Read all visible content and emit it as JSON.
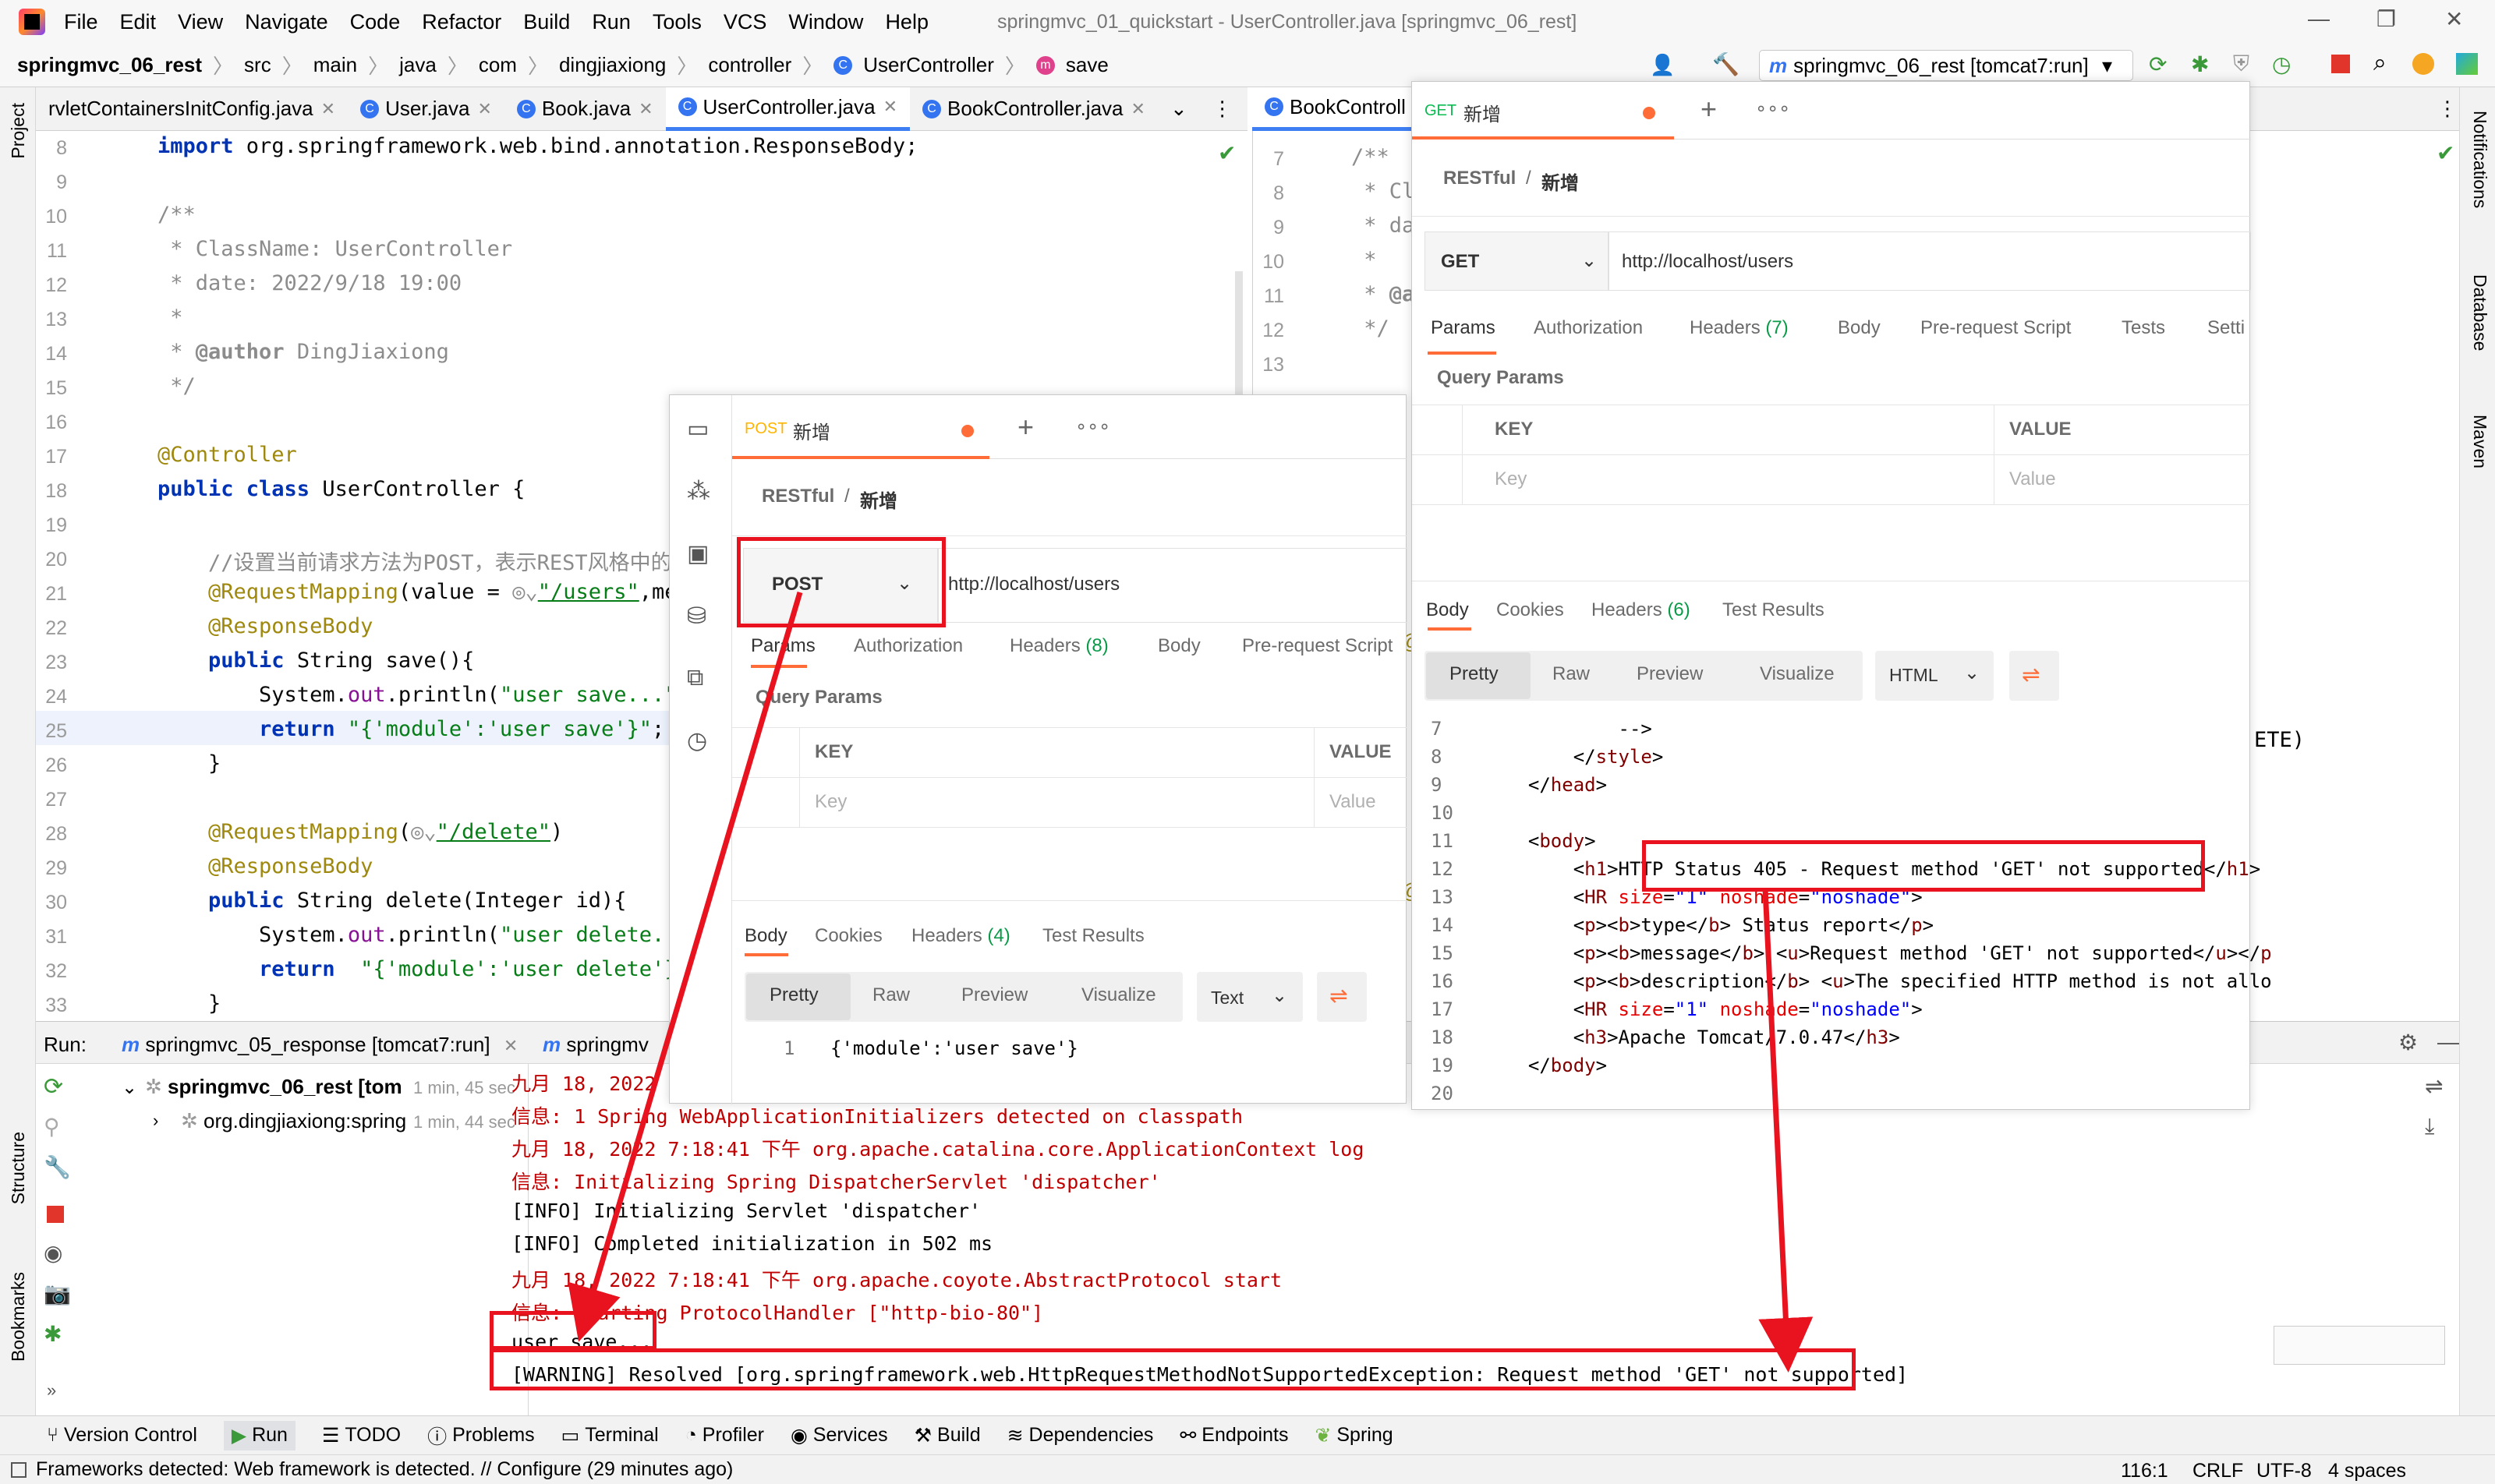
{
  "menu": {
    "items": [
      "File",
      "Edit",
      "View",
      "Navigate",
      "Code",
      "Refactor",
      "Build",
      "Run",
      "Tools",
      "VCS",
      "Window",
      "Help"
    ],
    "title": "springmvc_01_quickstart - UserController.java [springmvc_06_rest]"
  },
  "nav": {
    "crumbs": [
      "springmvc_06_rest",
      "src",
      "main",
      "java",
      "com",
      "dingjiaxiong",
      "controller",
      "UserController",
      "save"
    ],
    "run_config": "springmvc_06_rest [tomcat7:run]"
  },
  "left_tools": [
    "Project",
    "Structure",
    "Bookmarks"
  ],
  "right_tools": [
    "Notifications",
    "Database",
    "Maven"
  ],
  "editor_tabs": [
    "rvletContainersInitConfig.java",
    "User.java",
    "Book.java",
    "UserController.java",
    "BookController.java"
  ],
  "editor_tabs_right": [
    "BookControll"
  ],
  "editor": {
    "lines": [
      {
        "n": "8",
        "html": "<span class='kw'>import</span> org.springframework.web.bind.annotation.ResponseBody;"
      },
      {
        "n": "9",
        "html": ""
      },
      {
        "n": "10",
        "html": "<span class='cm'>/**</span>"
      },
      {
        "n": "11",
        "html": "<span class='cm'> * ClassName: UserController</span>"
      },
      {
        "n": "12",
        "html": "<span class='cm'> * date: 2022/9/18 19:00</span>"
      },
      {
        "n": "13",
        "html": "<span class='cm'> *</span>"
      },
      {
        "n": "14",
        "html": "<span class='cm'> * <b>@author</b> DingJiaxiong</span>"
      },
      {
        "n": "15",
        "html": "<span class='cm'> */</span>"
      },
      {
        "n": "16",
        "html": ""
      },
      {
        "n": "17",
        "html": "<span class='an'>@Controller</span>"
      },
      {
        "n": "18",
        "html": "<span class='kw'>public class</span> UserController {"
      },
      {
        "n": "19",
        "html": ""
      },
      {
        "n": "20",
        "html": "    <span class='cm'>//设置当前请求方法为POST，表示REST风格中的添</span>"
      },
      {
        "n": "21",
        "html": "    <span class='an'>@RequestMapping</span>(value = <span class='cm'>◎⌄</span><span class='lnk'>\"/users\"</span>,me"
      },
      {
        "n": "22",
        "html": "    <span class='an'>@ResponseBody</span>"
      },
      {
        "n": "23",
        "html": "    <span class='kw'>public</span> String save(){"
      },
      {
        "n": "24",
        "html": "        System.<span class='fld'>out</span>.println(<span class='str'>\"user save...\"</span>"
      },
      {
        "n": "25",
        "html": "        <span class='kw'>return</span> <span class='str'>\"{'module':'user save'}\"</span>;"
      },
      {
        "n": "26",
        "html": "    }"
      },
      {
        "n": "27",
        "html": ""
      },
      {
        "n": "28",
        "html": "    <span class='an'>@RequestMapping</span>(<span class='cm'>◎⌄</span><span class='lnk'>\"/delete\"</span>)"
      },
      {
        "n": "29",
        "html": "    <span class='an'>@ResponseBody</span>"
      },
      {
        "n": "30",
        "html": "    <span class='kw'>public</span> String delete(Integer id){"
      },
      {
        "n": "31",
        "html": "        System.<span class='fld'>out</span>.println(<span class='str'>\"user delete...</span>"
      },
      {
        "n": "32",
        "html": "        <span class='kw'>return</span>  <span class='str'>\"{'module':'user delete'}</span>"
      },
      {
        "n": "33",
        "html": "    }"
      }
    ]
  },
  "editor2": {
    "lines": [
      {
        "n": "7",
        "html": "<span class='cm'>/**</span>"
      },
      {
        "n": "8",
        "html": "<span class='cm'> * Cl</span>"
      },
      {
        "n": "9",
        "html": "<span class='cm'> * da</span>"
      },
      {
        "n": "10",
        "html": "<span class='cm'> *</span>"
      },
      {
        "n": "11",
        "html": "<span class='cm'> * <b>@a</b></span>"
      },
      {
        "n": "12",
        "html": "<span class='cm'> */</span>"
      },
      {
        "n": "13",
        "html": ""
      }
    ],
    "tail_text": "ETE)"
  },
  "postman_left": {
    "tab_method": "POST",
    "tab_name": "新增",
    "breadcrumb_a": "RESTful",
    "breadcrumb_sep": "/",
    "breadcrumb_b": "新增",
    "method": "POST",
    "url": "http://localhost/users",
    "req_tabs": [
      "Params",
      "Authorization",
      "Headers",
      "(8)",
      "Body",
      "Pre-request Script"
    ],
    "query_params": "Query Params",
    "col_key": "KEY",
    "col_value": "VALUE",
    "key_ph": "Key",
    "value_ph": "Value",
    "resp_tabs": [
      "Body",
      "Cookies",
      "Headers",
      "(4)",
      "Test Results"
    ],
    "view_tabs": [
      "Pretty",
      "Raw",
      "Preview",
      "Visualize"
    ],
    "format": "Text",
    "resp_line_no": "1",
    "resp_body": "{'module':'user save'}"
  },
  "postman_right": {
    "tab_method": "GET",
    "tab_name": "新增",
    "breadcrumb_a": "RESTful",
    "breadcrumb_sep": "/",
    "breadcrumb_b": "新增",
    "method": "GET",
    "url": "http://localhost/users",
    "req_tabs": [
      "Params",
      "Authorization",
      "Headers",
      "(7)",
      "Body",
      "Pre-request Script",
      "Tests",
      "Setti"
    ],
    "query_params": "Query Params",
    "col_key": "KEY",
    "col_value": "VALUE",
    "key_ph": "Key",
    "value_ph": "Value",
    "resp_tabs": [
      "Body",
      "Cookies",
      "Headers",
      "(6)",
      "Test Results"
    ],
    "view_tabs": [
      "Pretty",
      "Raw",
      "Preview",
      "Visualize"
    ],
    "format": "HTML",
    "resp_lines": [
      {
        "n": "7",
        "html": "          -->"
      },
      {
        "n": "8",
        "html": "      &lt;/<span class='tag'>style</span>&gt;"
      },
      {
        "n": "9",
        "html": "  &lt;/<span class='tag'>head</span>&gt;"
      },
      {
        "n": "10",
        "html": ""
      },
      {
        "n": "11",
        "html": "  &lt;<span class='tag'>body</span>&gt;"
      },
      {
        "n": "12",
        "html": "      &lt;<span class='tag'>h1</span>&gt;HTTP Status 405 - Request method 'GET' not supported&lt;/<span class='tag'>h1</span>&gt;"
      },
      {
        "n": "13",
        "html": "      &lt;<span class='tag'>HR</span> <span class='attr'>size</span>=<span class='aval'>\"1\"</span> <span class='attr'>noshade</span>=<span class='aval'>\"noshade\"</span>&gt;"
      },
      {
        "n": "14",
        "html": "      &lt;<span class='tag'>p</span>&gt;&lt;<span class='tag'>b</span>&gt;type&lt;/<span class='tag'>b</span>&gt; Status report&lt;/<span class='tag'>p</span>&gt;"
      },
      {
        "n": "15",
        "html": "      &lt;<span class='tag'>p</span>&gt;&lt;<span class='tag'>b</span>&gt;message&lt;/<span class='tag'>b</span>&gt; &lt;<span class='tag'>u</span>&gt;Request method 'GET' not supported&lt;/<span class='tag'>u</span>&gt;&lt;/<span class='tag'>p</span>"
      },
      {
        "n": "16",
        "html": "      &lt;<span class='tag'>p</span>&gt;&lt;<span class='tag'>b</span>&gt;description&lt;/<span class='tag'>b</span>&gt; &lt;<span class='tag'>u</span>&gt;The specified HTTP method is not allo"
      },
      {
        "n": "17",
        "html": "      &lt;<span class='tag'>HR</span> <span class='attr'>size</span>=<span class='aval'>\"1\"</span> <span class='attr'>noshade</span>=<span class='aval'>\"noshade\"</span>&gt;"
      },
      {
        "n": "18",
        "html": "      &lt;<span class='tag'>h3</span>&gt;Apache Tomcat/7.0.47&lt;/<span class='tag'>h3</span>&gt;"
      },
      {
        "n": "19",
        "html": "  &lt;/<span class='tag'>body</span>&gt;"
      },
      {
        "n": "20",
        "html": ""
      }
    ]
  },
  "run": {
    "label": "Run:",
    "tabs": [
      "springmvc_05_response [tomcat7:run]",
      "springmv"
    ],
    "tree": [
      {
        "name": "springmvc_06_rest [tom",
        "time": "1 min, 45 sec"
      },
      {
        "name": "org.dingjiaxiong:spring",
        "time": "1 min, 44 sec"
      }
    ],
    "log": [
      {
        "cls": "red",
        "text": "九月 18, 2022 7"
      },
      {
        "cls": "red",
        "text": "信息: 1 Spring WebApplicationInitializers detected on classpath"
      },
      {
        "cls": "red",
        "text": "九月 18, 2022 7:18:41 下午 org.apache.catalina.core.ApplicationContext log"
      },
      {
        "cls": "red",
        "text": "信息: Initializing Spring DispatcherServlet 'dispatcher'"
      },
      {
        "cls": "",
        "text": "[INFO] Initializing Servlet 'dispatcher'"
      },
      {
        "cls": "",
        "text": "[INFO] Completed initialization in 502 ms"
      },
      {
        "cls": "red",
        "text": "九月 18, 2022 7:18:41 下午 org.apache.coyote.AbstractProtocol start"
      },
      {
        "cls": "red",
        "text": "信息: Starting ProtocolHandler [\"http-bio-80\"]"
      },
      {
        "cls": "",
        "text": "user save..."
      },
      {
        "cls": "",
        "text": "[WARNING] Resolved [org.springframework.web.HttpRequestMethodNotSupportedException: Request method 'GET' not supported]"
      }
    ]
  },
  "toolwindows": [
    "Version Control",
    "Run",
    "TODO",
    "Problems",
    "Terminal",
    "Profiler",
    "Services",
    "Build",
    "Dependencies",
    "Endpoints",
    "Spring"
  ],
  "status": {
    "message": "Frameworks detected: Web framework is detected. // Configure (29 minutes ago)",
    "position": "116:1",
    "line_sep": "CRLF",
    "encoding": "UTF-8",
    "indent": "4 spaces"
  },
  "colors": {
    "accent": "#3d7ef2",
    "postman": "#ff6c37",
    "annotation_red": "#e8131f"
  }
}
